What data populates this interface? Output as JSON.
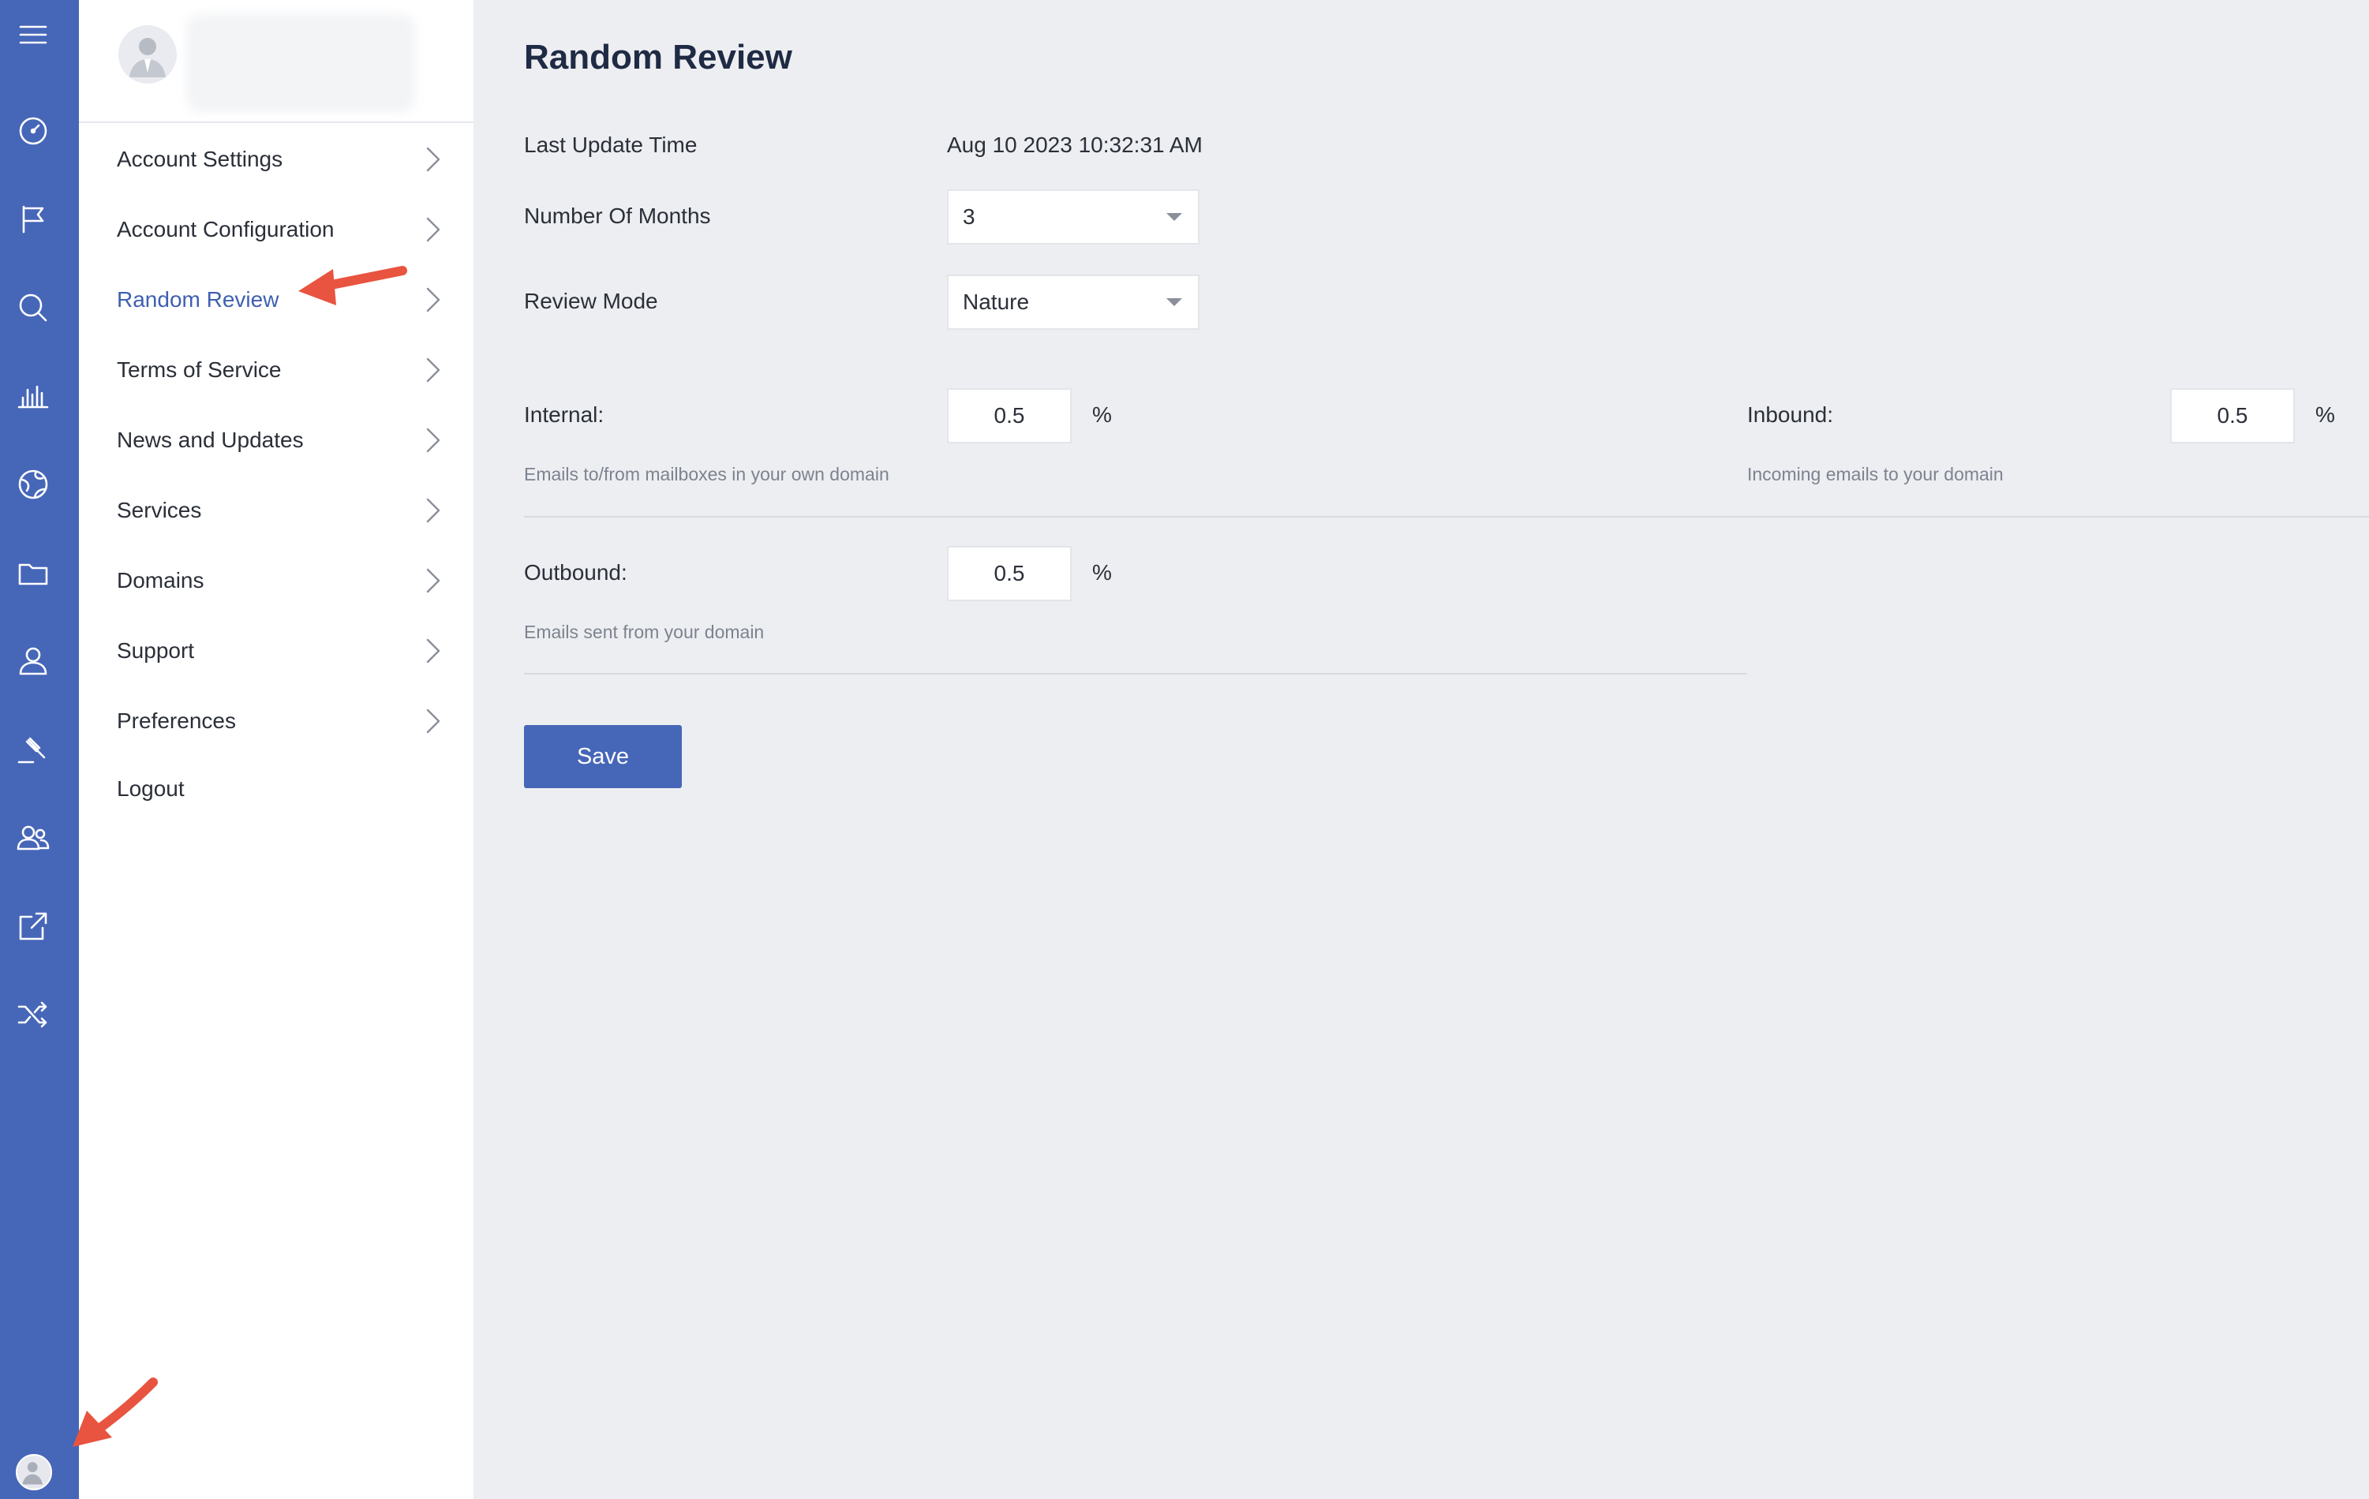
{
  "rail": {
    "icons": [
      "hamburger-menu-icon",
      "dashboard-gauge-icon",
      "flag-icon",
      "search-icon",
      "bar-chart-icon",
      "globe-icon",
      "folder-icon",
      "user-icon",
      "gavel-icon",
      "users-group-icon",
      "external-link-icon",
      "shuffle-icon"
    ]
  },
  "menu": {
    "items": [
      {
        "label": "Account Settings",
        "has_chevron": true
      },
      {
        "label": "Account Configuration",
        "has_chevron": true
      },
      {
        "label": "Random Review",
        "has_chevron": true,
        "active": true
      },
      {
        "label": "Terms of Service",
        "has_chevron": true
      },
      {
        "label": "News and Updates",
        "has_chevron": true
      },
      {
        "label": "Services",
        "has_chevron": true
      },
      {
        "label": "Domains",
        "has_chevron": true
      },
      {
        "label": "Support",
        "has_chevron": true
      },
      {
        "label": "Preferences",
        "has_chevron": true
      },
      {
        "label": "Logout",
        "has_chevron": false
      }
    ]
  },
  "main": {
    "title": "Random Review",
    "last_update": {
      "label": "Last Update Time",
      "value": "Aug 10 2023 10:32:31 AM"
    },
    "months": {
      "label": "Number Of Months",
      "value": "3"
    },
    "review_mode": {
      "label": "Review Mode",
      "value": "Nature"
    },
    "internal": {
      "label": "Internal:",
      "value": "0.5",
      "unit": "%",
      "hint": "Emails to/from mailboxes in your own domain"
    },
    "inbound": {
      "label": "Inbound:",
      "value": "0.5",
      "unit": "%",
      "hint": "Incoming emails to your domain"
    },
    "outbound": {
      "label": "Outbound:",
      "value": "0.5",
      "unit": "%",
      "hint": "Emails sent from your domain"
    },
    "save_label": "Save"
  },
  "colors": {
    "rail": "#4666b8",
    "accent": "#3f5fb0",
    "page_bg": "#eceef1",
    "annotation_arrow": "#e8543f"
  }
}
